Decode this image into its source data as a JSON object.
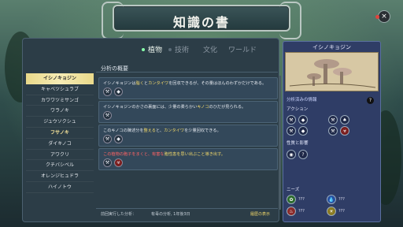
{
  "title": "知識の書",
  "close_label": "×",
  "tabs": [
    {
      "label": "植物",
      "active": true
    },
    {
      "label": "技術",
      "active": false
    },
    {
      "label": "文化",
      "active": false
    },
    {
      "label": "ワールド",
      "active": false
    }
  ],
  "plants": [
    {
      "name": "イシノキョジン",
      "selected": true
    },
    {
      "name": "キャベツシュラブ"
    },
    {
      "name": "カワワツミサンゴ"
    },
    {
      "name": "ワラノキ"
    },
    {
      "name": "ジュウソクシュ"
    },
    {
      "name": "フサノキ",
      "highlight": true
    },
    {
      "name": "ダイキノコ"
    },
    {
      "name": "アワクリ"
    },
    {
      "name": "クチバシベル"
    },
    {
      "name": "オレンジヒュドラ"
    },
    {
      "name": "ハイノトウ"
    }
  ],
  "detail": {
    "header": "分析の概要",
    "cards": [
      {
        "pre": "イシノキョジンは",
        "y1": "脂く",
        "mid": "と",
        "y2": "カンタイワ",
        "post": "を回収できるが、その量はほんのわずかだけである。"
      },
      {
        "pre": "イシノキョジンのかさの裏面には、少量の柔らかい",
        "y1": "キノコ",
        "mid": "のひだが見られる。",
        "y2": "",
        "post": ""
      },
      {
        "pre": "このキノコの陳述分を",
        "y1": "整える",
        "mid": "と、",
        "y2": "カンタイワ",
        "post": "を少量回収できる。"
      },
      {
        "pre": "この植物の胞子を",
        "y1": "",
        "mid": "まくと、有害な",
        "y2": "",
        "post": "胞性患を思い出ぶこと導き出す。",
        "red": true
      }
    ],
    "footer_label": "前回実行した分析：",
    "footer_value": "有毒の分析, 1年後3日",
    "footer_link": "履歴の表示"
  },
  "info": {
    "title": "イシノキョジン",
    "analysis_label": "分析済みの情報",
    "actions_label": "アクション",
    "traits_label": "性質と影響",
    "needs_label": "ニーズ",
    "qmark": "?",
    "unknown": "???"
  }
}
